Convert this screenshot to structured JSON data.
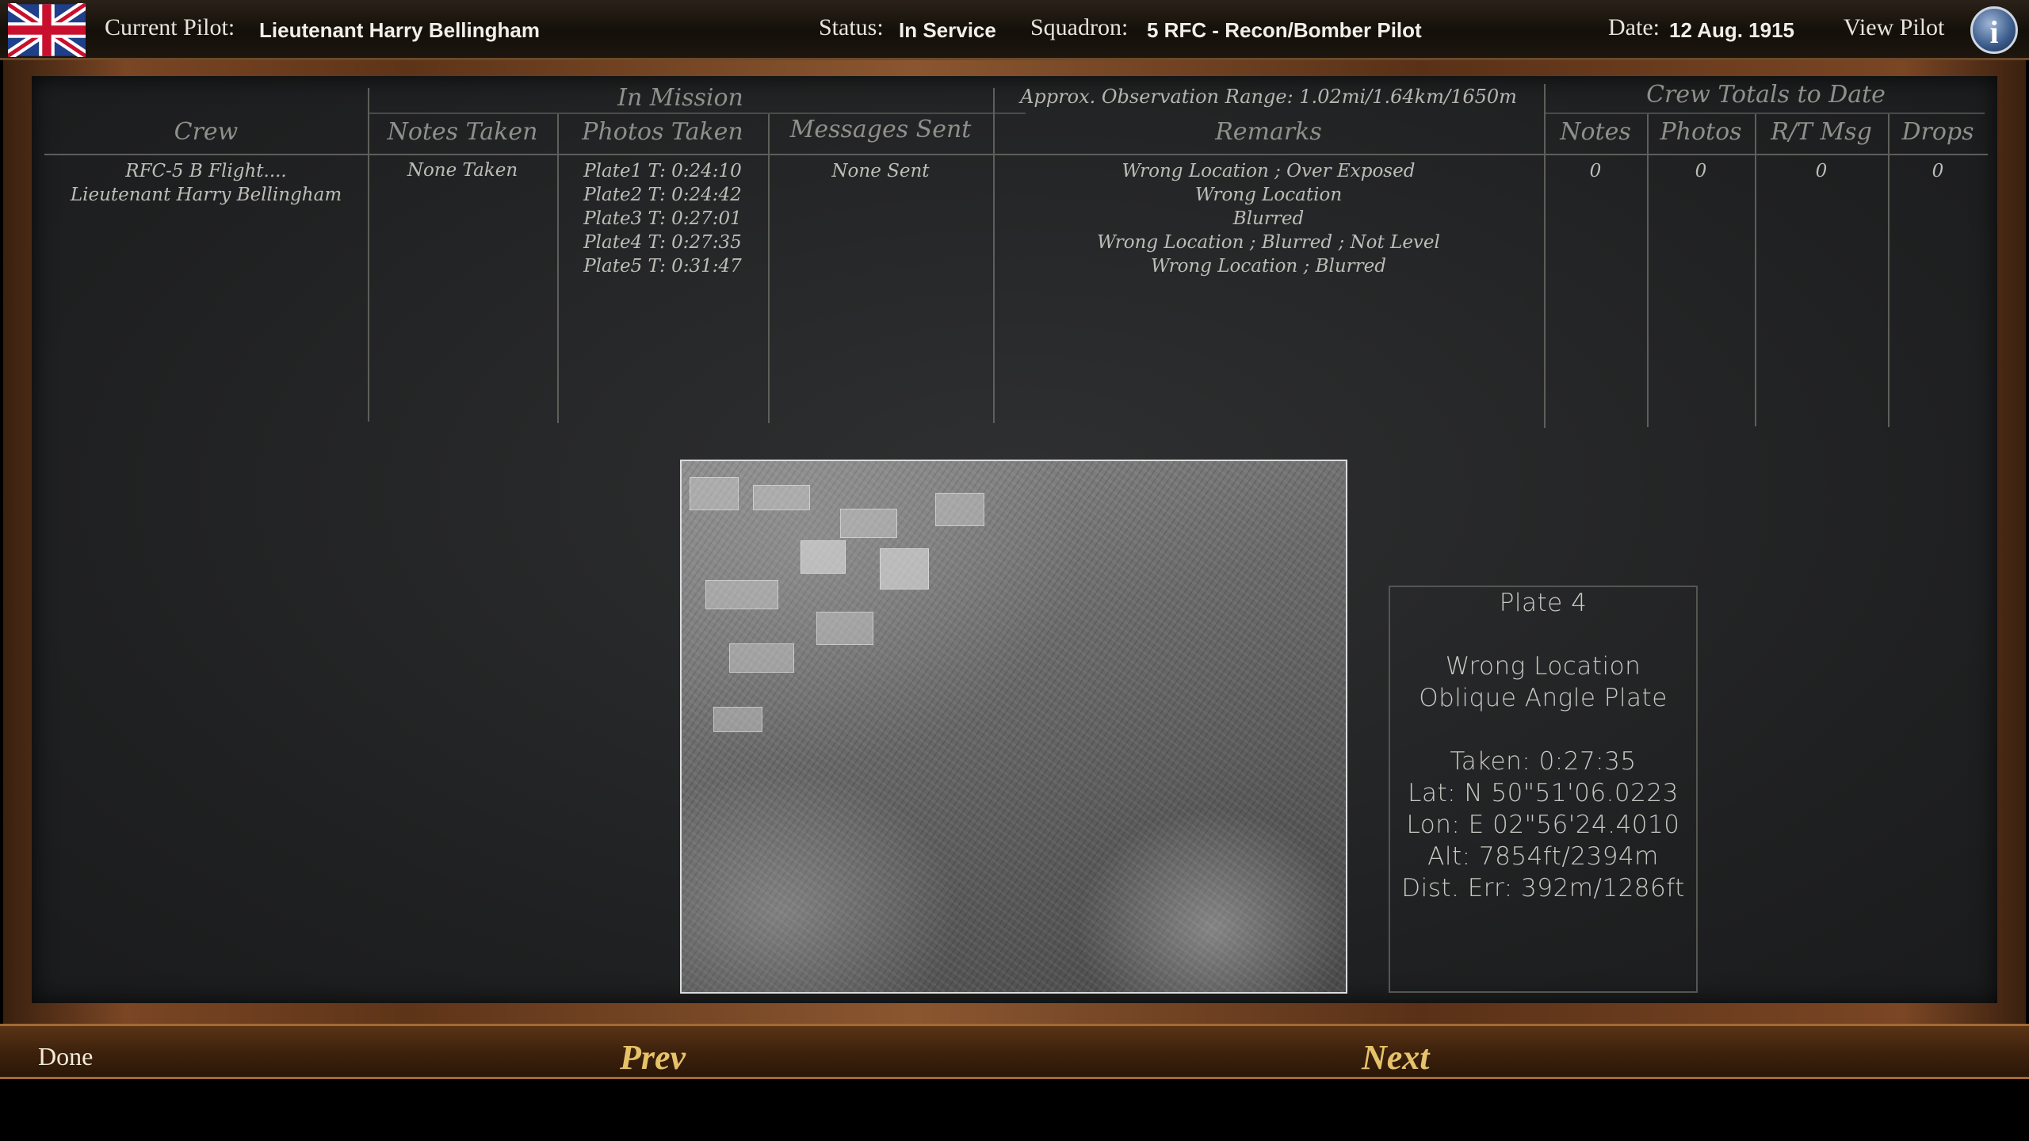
{
  "topbar": {
    "pilot_label": "Current Pilot:",
    "pilot_name": "Lieutenant Harry Bellingham",
    "status_label": "Status:",
    "status_value": "In Service",
    "squadron_label": "Squadron:",
    "squadron_value": "5 RFC - Recon/Bomber Pilot",
    "date_label": "Date:",
    "date_value": "12 Aug. 1915",
    "view_pilot": "View Pilot",
    "info_glyph": "i",
    "flag_icon": "union-jack-flag-icon"
  },
  "table": {
    "group_in_mission": "In Mission",
    "observation_range": "Approx. Observation Range: 1.02mi/1.64km/1650m",
    "group_crew_totals": "Crew Totals to Date",
    "headers": {
      "crew": "Crew",
      "notes_taken": "Notes Taken",
      "photos_taken": "Photos Taken",
      "messages_sent": "Messages Sent",
      "remarks": "Remarks",
      "notes": "Notes",
      "photos": "Photos",
      "rt_msg": "R/T Msg",
      "drops": "Drops"
    },
    "row": {
      "crew": "RFC-5 B Flight....\nLieutenant Harry Bellingham",
      "notes_taken": "None Taken",
      "photos_taken": "Plate1 T: 0:24:10\nPlate2 T: 0:24:42\nPlate3 T: 0:27:01\nPlate4 T: 0:27:35\nPlate5 T: 0:31:47",
      "messages_sent": "None Sent",
      "remarks": "Wrong Location ; Over Exposed\nWrong Location\nBlurred\nWrong Location ; Blurred ; Not Level\nWrong Location ; Blurred",
      "notes": "0",
      "photos": "0",
      "rt_msg": "0",
      "drops": "0"
    }
  },
  "plate_info": {
    "title": "Plate 4",
    "line1": "Wrong Location",
    "line2": "Oblique Angle Plate",
    "taken": "Taken: 0:27:35",
    "lat": "Lat: N 50\"51'06.0223",
    "lon": "Lon: E 02\"56'24.4010",
    "alt": "Alt: 7854ft/2394m",
    "dist_err": "Dist. Err: 392m/1286ft"
  },
  "bottom": {
    "done": "Done",
    "prev": "Prev",
    "next": "Next"
  },
  "colors": {
    "chalkboard": "#232425",
    "wood_frame": "#7a4624",
    "nav_gold": "#e6c26a"
  }
}
